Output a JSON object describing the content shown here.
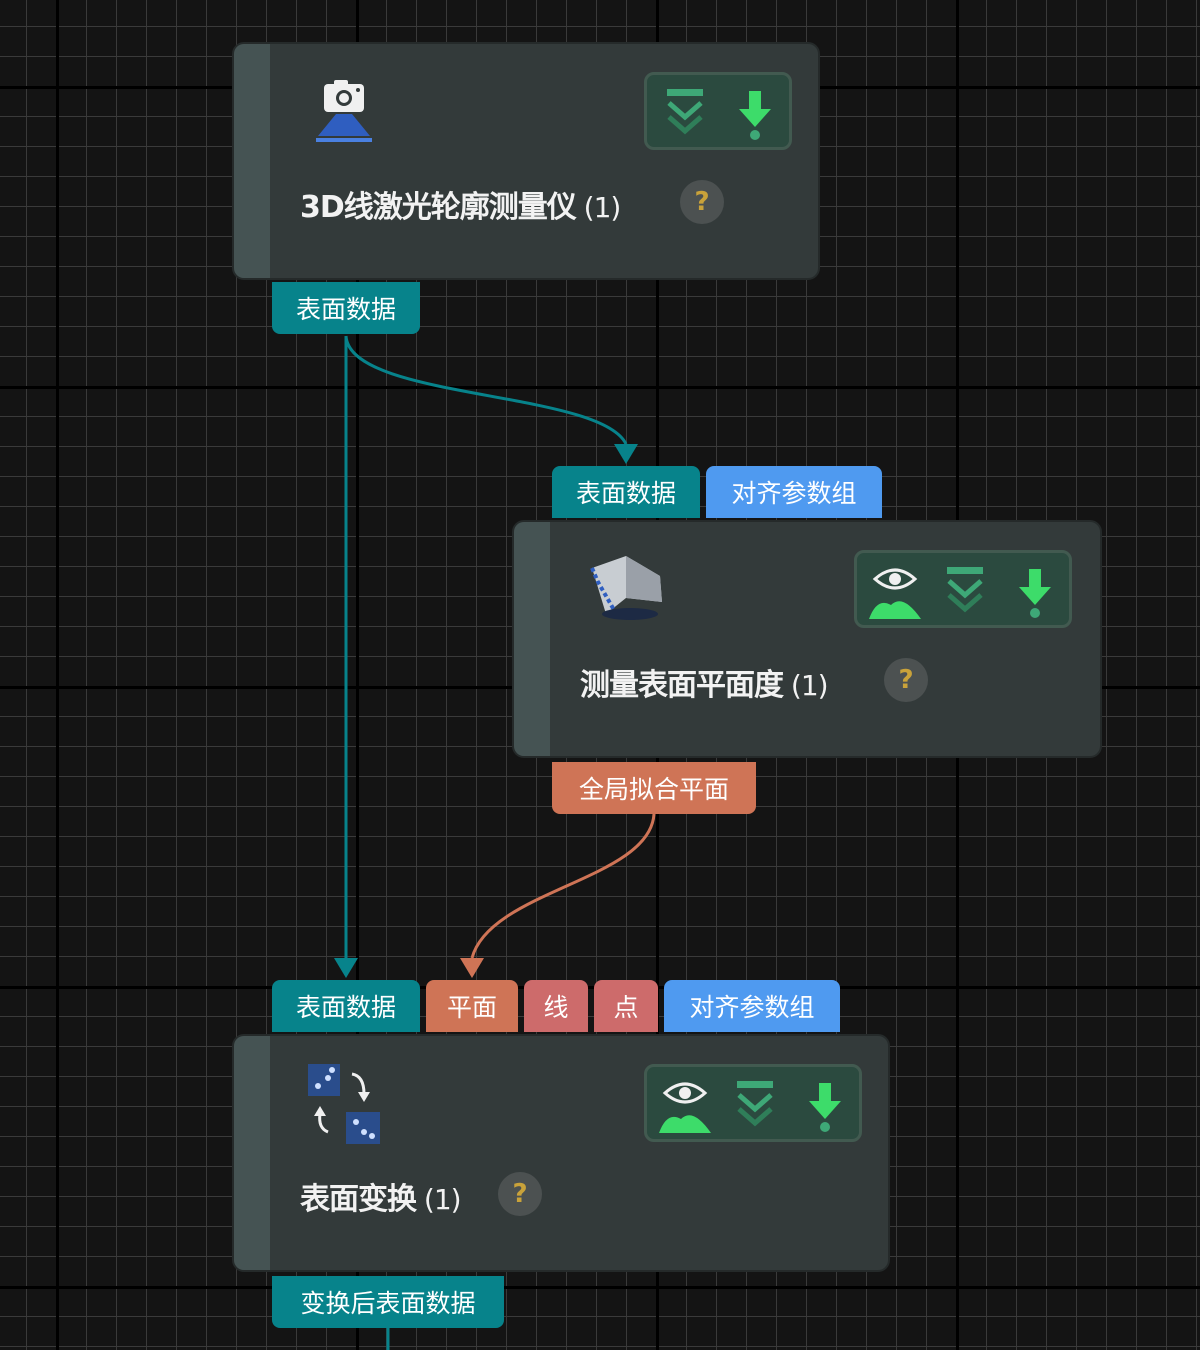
{
  "colors": {
    "teal": "#07838b",
    "blue": "#4f9af0",
    "orange": "#cf7456",
    "red": "#cd6b6b",
    "tool_green": "#3ddc6a"
  },
  "nodes": {
    "profiler": {
      "title": "3D线激光轮廓测量仪",
      "count": " (1)",
      "icon": "camera-icon",
      "tools": [
        "step-over-icon",
        "download-icon"
      ],
      "outputs": [
        "表面数据"
      ]
    },
    "flatness": {
      "title": "测量表面平面度",
      "count": " (1)",
      "icon": "surface-icon",
      "tools": [
        "visualize-icon",
        "step-over-icon",
        "download-icon"
      ],
      "inputs": [
        "表面数据",
        "对齐参数组"
      ],
      "outputs": [
        "全局拟合平面"
      ]
    },
    "transform": {
      "title": "表面变换",
      "count": " (1)",
      "icon": "transform-icon",
      "tools": [
        "visualize-icon",
        "step-over-icon",
        "download-icon"
      ],
      "inputs": [
        "表面数据",
        "平面",
        "线",
        "点",
        "对齐参数组"
      ],
      "outputs": [
        "变换后表面数据"
      ]
    }
  },
  "help_symbol": "?"
}
